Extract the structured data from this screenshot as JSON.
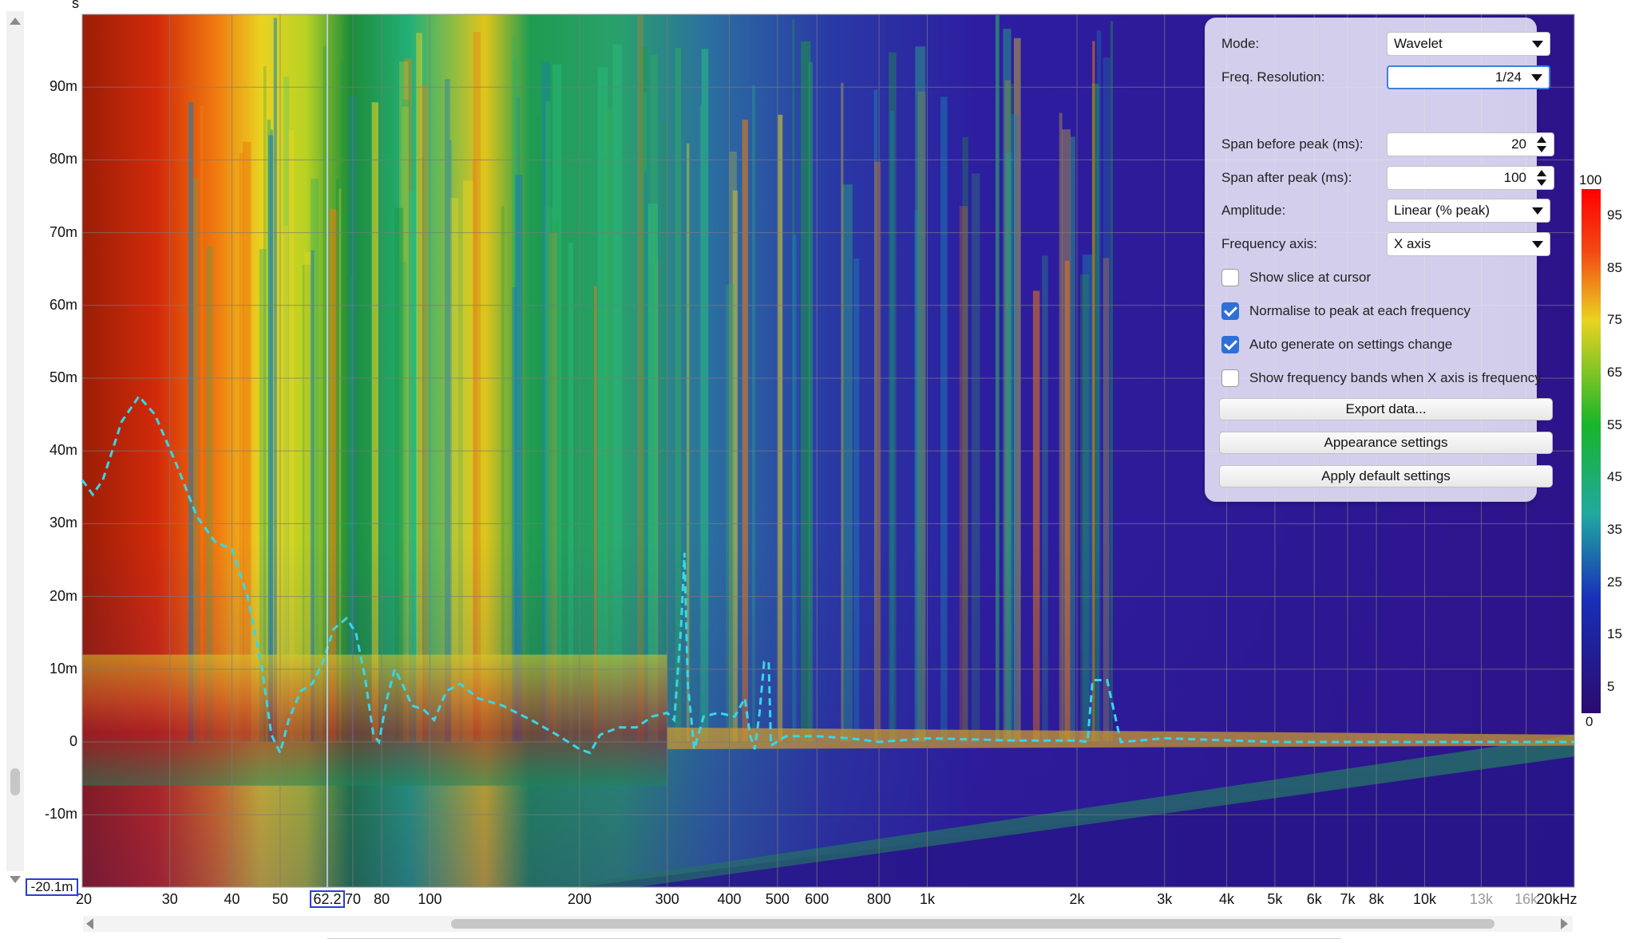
{
  "y_axis": {
    "unit": "s",
    "ticks": [
      "90m",
      "80m",
      "70m",
      "60m",
      "50m",
      "40m",
      "30m",
      "20m",
      "10m",
      "0",
      "-10m"
    ],
    "tick_values_ms": [
      90,
      80,
      70,
      60,
      50,
      40,
      30,
      20,
      10,
      0,
      -10
    ],
    "cursor_readout": "-20.1m"
  },
  "x_axis": {
    "ticks": [
      {
        "label": "20",
        "hz": 20,
        "muted": false
      },
      {
        "label": "30",
        "hz": 30,
        "muted": false
      },
      {
        "label": "40",
        "hz": 40,
        "muted": false
      },
      {
        "label": "50",
        "hz": 50,
        "muted": false
      },
      {
        "label": "70",
        "hz": 70,
        "muted": false
      },
      {
        "label": "80",
        "hz": 80,
        "muted": false
      },
      {
        "label": "100",
        "hz": 100,
        "muted": false
      },
      {
        "label": "200",
        "hz": 200,
        "muted": false
      },
      {
        "label": "300",
        "hz": 300,
        "muted": false
      },
      {
        "label": "400",
        "hz": 400,
        "muted": false
      },
      {
        "label": "500",
        "hz": 500,
        "muted": false
      },
      {
        "label": "600",
        "hz": 600,
        "muted": false
      },
      {
        "label": "800",
        "hz": 800,
        "muted": false
      },
      {
        "label": "1k",
        "hz": 1000,
        "muted": false
      },
      {
        "label": "2k",
        "hz": 2000,
        "muted": false
      },
      {
        "label": "3k",
        "hz": 3000,
        "muted": false
      },
      {
        "label": "4k",
        "hz": 4000,
        "muted": false
      },
      {
        "label": "5k",
        "hz": 5000,
        "muted": false
      },
      {
        "label": "6k",
        "hz": 6000,
        "muted": false
      },
      {
        "label": "7k",
        "hz": 7000,
        "muted": false
      },
      {
        "label": "8k",
        "hz": 8000,
        "muted": false
      },
      {
        "label": "10k",
        "hz": 10000,
        "muted": false
      },
      {
        "label": "13k",
        "hz": 13000,
        "muted": true
      },
      {
        "label": "16k",
        "hz": 16000,
        "muted": true
      },
      {
        "label": "20kHz",
        "hz": 20000,
        "muted": false
      }
    ],
    "cursor_readout": "62.2",
    "cursor_hz": 62.2
  },
  "colorbar": {
    "labels": [
      "100",
      "95",
      "85",
      "75",
      "65",
      "55",
      "45",
      "35",
      "25",
      "15",
      "5",
      "0"
    ],
    "label_values": [
      100,
      95,
      85,
      75,
      65,
      55,
      45,
      35,
      25,
      15,
      5,
      0
    ]
  },
  "panel": {
    "mode_label": "Mode:",
    "mode_value": "Wavelet",
    "freq_res_label": "Freq. Resolution:",
    "freq_res_value": "1/24",
    "span_before_label": "Span before peak (ms):",
    "span_before_value": "20",
    "span_after_label": "Span after peak (ms):",
    "span_after_value": "100",
    "amplitude_label": "Amplitude:",
    "amplitude_value": "Linear (% peak)",
    "freq_axis_label": "Frequency axis:",
    "freq_axis_value": "X axis",
    "checkboxes": [
      {
        "label": "Show slice at cursor",
        "checked": false
      },
      {
        "label": "Normalise to peak at each frequency",
        "checked": true
      },
      {
        "label": "Auto generate on settings change",
        "checked": true
      },
      {
        "label": "Show frequency bands when X axis is frequency",
        "checked": false
      }
    ],
    "export_button": "Export data...",
    "appearance_button": "Appearance settings",
    "default_button": "Apply default settings"
  },
  "icons": {
    "scroll_up": "triangle-up-icon",
    "scroll_down": "triangle-down-icon",
    "scroll_left": "triangle-left-icon",
    "scroll_right": "triangle-right-icon",
    "spin": "up-down-arrows-icon",
    "dropdown": "chevron-down-icon"
  },
  "colors": {
    "cursor_box_border": "#2a3fd6",
    "peak_trace": "#38d6e8",
    "check_blue": "#2f6fd8",
    "panel_bg": "#eeecfa"
  }
}
